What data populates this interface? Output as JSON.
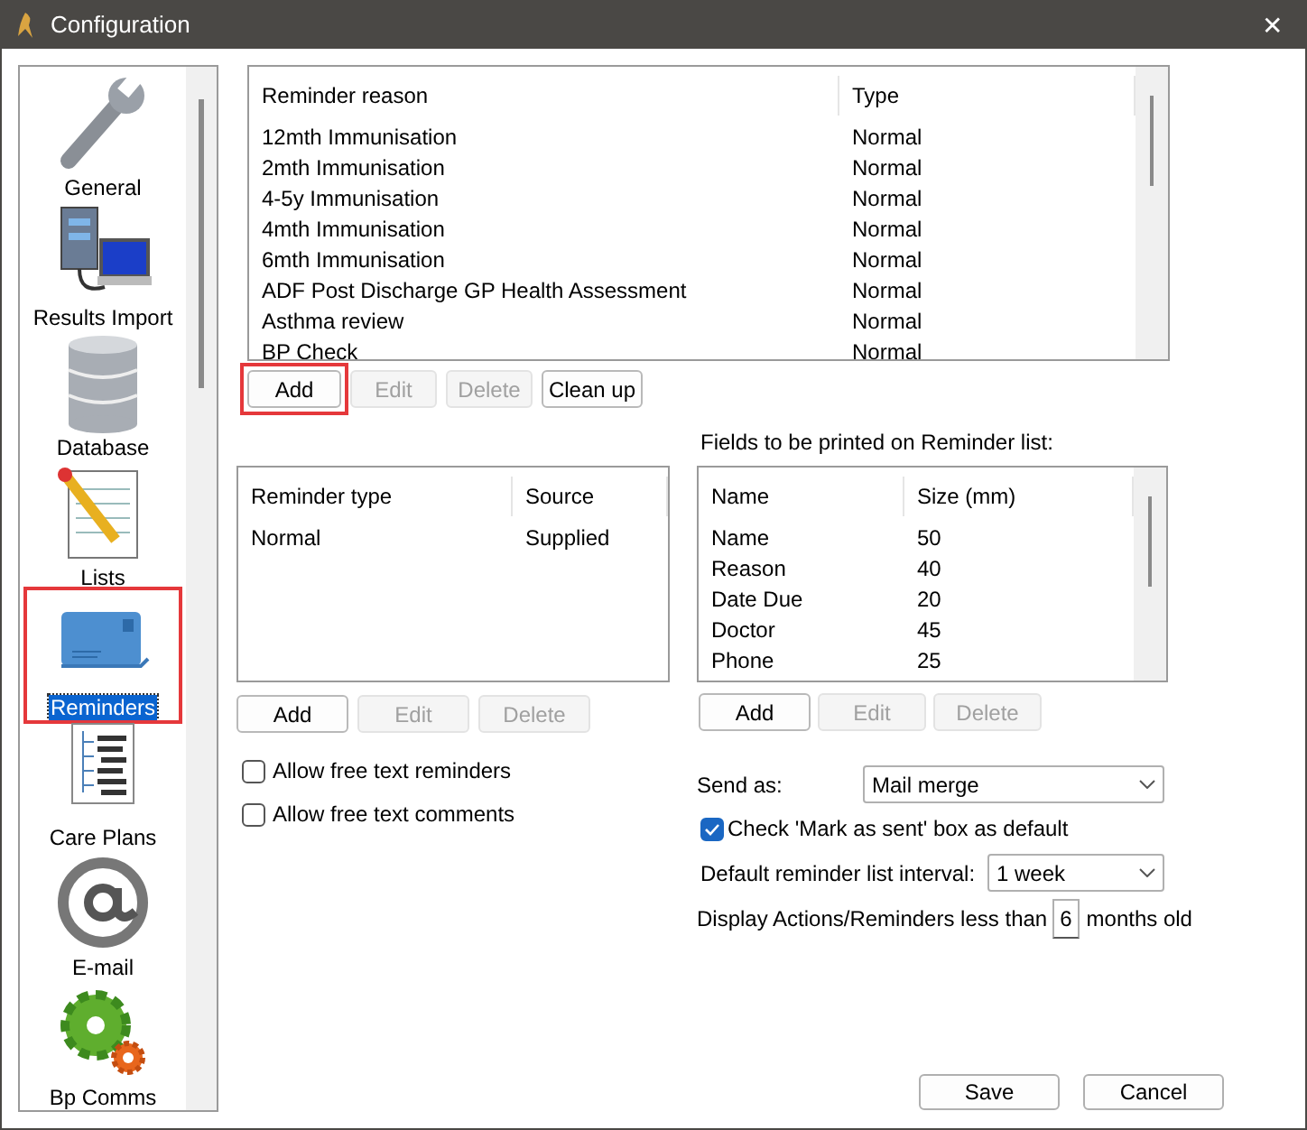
{
  "window": {
    "title": "Configuration",
    "close": "✕"
  },
  "sidebar": {
    "items": [
      {
        "label": "General",
        "selected": false,
        "highlighted": false
      },
      {
        "label": "Results Import",
        "selected": false,
        "highlighted": false
      },
      {
        "label": "Database",
        "selected": false,
        "highlighted": false
      },
      {
        "label": "Lists",
        "selected": false,
        "highlighted": false
      },
      {
        "label": "Reminders",
        "selected": true,
        "highlighted": true
      },
      {
        "label": "Care Plans",
        "selected": false,
        "highlighted": false
      },
      {
        "label": "E-mail",
        "selected": false,
        "highlighted": false
      },
      {
        "label": "Bp Comms",
        "selected": false,
        "highlighted": false
      }
    ]
  },
  "reasons_table": {
    "columns": [
      "Reminder reason",
      "Type"
    ],
    "rows": [
      [
        "12mth Immunisation",
        "Normal"
      ],
      [
        "2mth Immunisation",
        "Normal"
      ],
      [
        "4-5y Immunisation",
        "Normal"
      ],
      [
        "4mth Immunisation",
        "Normal"
      ],
      [
        "6mth Immunisation",
        "Normal"
      ],
      [
        "ADF Post Discharge GP Health Assessment",
        "Normal"
      ],
      [
        "Asthma review",
        "Normal"
      ],
      [
        "BP Check",
        "Normal"
      ]
    ],
    "buttons": [
      {
        "label": "Add",
        "disabled": false,
        "highlighted": true
      },
      {
        "label": "Edit",
        "disabled": true,
        "highlighted": false
      },
      {
        "label": "Delete",
        "disabled": true,
        "highlighted": false
      },
      {
        "label": "Clean up",
        "disabled": false,
        "highlighted": false
      }
    ]
  },
  "types_table": {
    "columns": [
      "Reminder type",
      "Source"
    ],
    "rows": [
      [
        "Normal",
        "Supplied"
      ]
    ],
    "buttons": [
      {
        "label": "Add",
        "disabled": false,
        "highlighted": false
      },
      {
        "label": "Edit",
        "disabled": true,
        "highlighted": false
      },
      {
        "label": "Delete",
        "disabled": true,
        "highlighted": false
      }
    ]
  },
  "checkboxes": [
    {
      "label": "Allow free text reminders",
      "checked": false
    },
    {
      "label": "Allow free text comments",
      "checked": false
    }
  ],
  "fields_table": {
    "title": "Fields to be printed on Reminder list:",
    "columns": [
      "Name",
      "Size (mm)"
    ],
    "rows": [
      [
        "Name",
        "50"
      ],
      [
        "Reason",
        "40"
      ],
      [
        "Date Due",
        "20"
      ],
      [
        "Doctor",
        "45"
      ],
      [
        "Phone",
        "25"
      ]
    ],
    "buttons": [
      {
        "label": "Add",
        "disabled": false,
        "highlighted": false
      },
      {
        "label": "Edit",
        "disabled": true,
        "highlighted": false
      },
      {
        "label": "Delete",
        "disabled": true,
        "highlighted": false
      }
    ]
  },
  "send_as": {
    "label": "Send as:",
    "value": "Mail merge"
  },
  "mark_as_sent": {
    "label": "Check 'Mark as sent' box as default",
    "checked": true
  },
  "interval": {
    "label": "Default reminder list interval:",
    "value": "1 week"
  },
  "display": {
    "label": "Display Actions/Reminders less than",
    "value": "6",
    "suffix": "months old"
  },
  "footer_buttons": [
    {
      "label": "Save"
    },
    {
      "label": "Cancel"
    }
  ]
}
